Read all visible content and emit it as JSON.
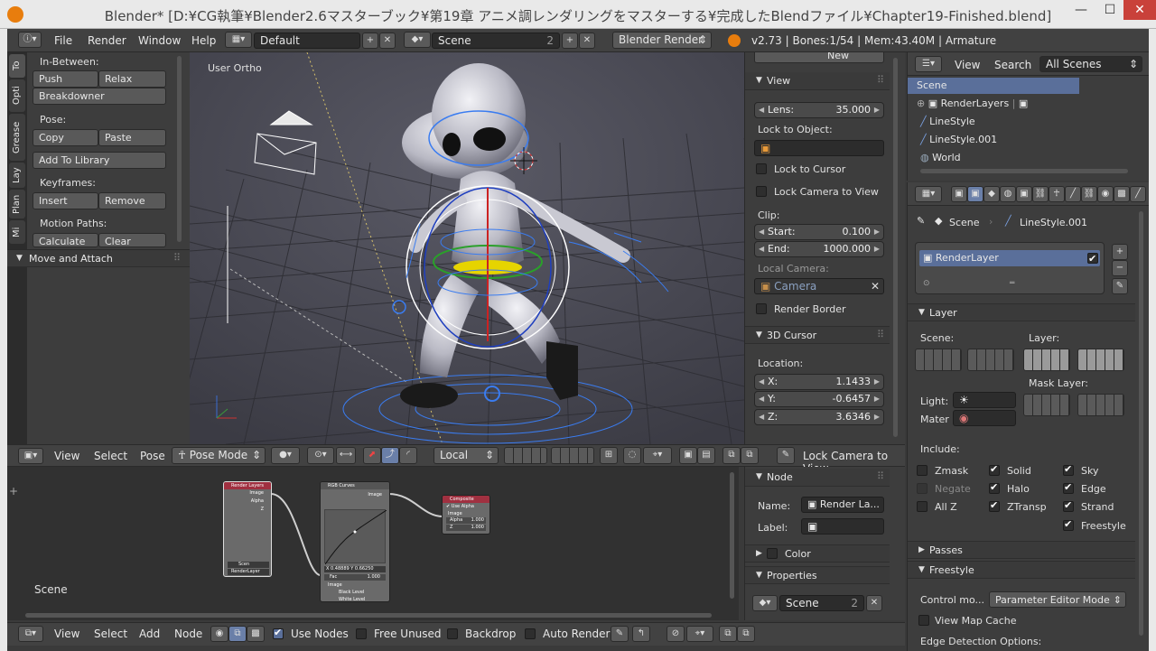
{
  "window": {
    "title": "Blender* [D:¥CG執筆¥Blender2.6マスターブック¥第19章 アニメ調レンダリングをマスターする¥完成したBlendファイル¥Chapter19-Finished.blend]"
  },
  "menubar": {
    "menus": [
      "File",
      "Render",
      "Window",
      "Help"
    ],
    "screen_layout": "Default",
    "scene": "Scene",
    "scene_count": "2",
    "render_engine": "Blender Render",
    "stats": "v2.73 | Bones:1/54 | Mem:43.40M | Armature"
  },
  "toolshelf": {
    "tabs": [
      "To",
      "Opti",
      "Grease",
      "Lay",
      "Plan",
      "Mi"
    ],
    "inbetween_label": "In-Between:",
    "push": "Push",
    "relax": "Relax",
    "breakdowner": "Breakdowner",
    "pose_label": "Pose:",
    "copy": "Copy",
    "paste": "Paste",
    "add_to_library": "Add To Library",
    "keyframes_label": "Keyframes:",
    "insert": "Insert",
    "remove": "Remove",
    "motion_paths_label": "Motion Paths:",
    "calculate": "Calculate",
    "clear": "Clear",
    "move_attach": "Move and Attach"
  },
  "viewport": {
    "label": "User Ortho"
  },
  "view_header": {
    "menus": [
      "View",
      "Select",
      "Pose"
    ],
    "mode": "Pose Mode",
    "orientation": "Local",
    "lock_camera": "Lock Camera to View"
  },
  "nprops": {
    "new_btn": "New",
    "view_header": "View",
    "lens_label": "Lens:",
    "lens_value": "35.000",
    "lock_to_object": "Lock to Object:",
    "lock_cursor": "Lock to Cursor",
    "lock_camera": "Lock Camera to View",
    "clip_label": "Clip:",
    "start_label": "Start:",
    "start_value": "0.100",
    "end_label": "End:",
    "end_value": "1000.000",
    "local_camera": "Local Camera:",
    "camera": "Camera",
    "render_border": "Render Border",
    "cursor_header": "3D Cursor",
    "location_label": "Location:",
    "x_label": "X:",
    "x_value": "1.1433",
    "y_label": "Y:",
    "y_value": "-0.6457",
    "z_label": "Z:",
    "z_value": "3.6346"
  },
  "outliner": {
    "menus": [
      "View",
      "Search"
    ],
    "filter": "All Scenes",
    "items": [
      "Scene",
      "RenderLayers",
      "LineStyle",
      "LineStyle.001",
      "World"
    ]
  },
  "properties": {
    "breadcrumb_scene": "Scene",
    "breadcrumb_linestyle": "LineStyle.001",
    "renderlayer": "RenderLayer",
    "layer_header": "Layer",
    "scene_label": "Scene:",
    "layer_label": "Layer:",
    "mask_layer": "Mask Layer:",
    "light": "Light:",
    "mater": "Mater",
    "include": "Include:",
    "zmask": "Zmask",
    "negate": "Negate",
    "allz": "All Z",
    "solid": "Solid",
    "halo": "Halo",
    "ztransp": "ZTransp",
    "sky": "Sky",
    "edge": "Edge",
    "strand": "Strand",
    "freestyle": "Freestyle",
    "passes": "Passes",
    "freestyle_header": "Freestyle",
    "control_mode": "Control mo...",
    "control_mode_value": "Parameter Editor Mode",
    "view_map_cache": "View Map Cache",
    "edge_detection": "Edge Detection Options:"
  },
  "node_editor": {
    "scene_label": "Scene",
    "nodes": {
      "render_layers": {
        "title": "Render Layers",
        "out1": "Image",
        "out2": "Alpha",
        "out3": "Z",
        "scene": "Scen",
        "layer": "RenderLayer"
      },
      "rgb_curves": {
        "title": "RGB Curves",
        "out": "Image",
        "coord": "X 0.48889   Y 0.66250",
        "fac_label": "Fac",
        "fac_value": "1.000",
        "in_image": "Image",
        "black": "Black Level",
        "white": "White Level"
      },
      "composite": {
        "title": "Composite",
        "use_alpha": "Use Alpha",
        "image": "Image",
        "alpha": "Alpha",
        "alpha_value": "1.000",
        "z": "Z",
        "z_value": "1.000"
      }
    }
  },
  "node_sidebar": {
    "node_header": "Node",
    "name_label": "Name:",
    "name_value": "Render La...",
    "label_label": "Label:",
    "color": "Color",
    "properties": "Properties",
    "scene": "Scene",
    "scene_count": "2"
  },
  "node_header": {
    "menus": [
      "View",
      "Select",
      "Add",
      "Node"
    ],
    "use_nodes": "Use Nodes",
    "free_unused": "Free Unused",
    "backdrop": "Backdrop",
    "auto_render": "Auto Render"
  }
}
